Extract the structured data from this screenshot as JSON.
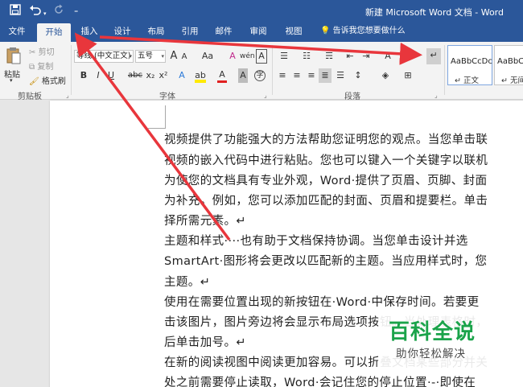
{
  "titlebar": {
    "save_icon": "save-icon",
    "undo_icon": "undo-icon",
    "redo_icon": "redo-icon",
    "customize_icon": "customize-qat-icon",
    "title": "新建 Microsoft Word 文档 - Word"
  },
  "tabs": [
    "文件",
    "开始",
    "插入",
    "设计",
    "布局",
    "引用",
    "邮件",
    "审阅",
    "视图"
  ],
  "active_tab": "开始",
  "tell_me": "告诉我您想要做什么",
  "clipboard": {
    "paste": "粘贴",
    "cut": "剪切",
    "copy": "复制",
    "format_painter": "格式刷",
    "group_label": "剪贴板"
  },
  "font": {
    "font_name": "等线 (中文正文)",
    "font_size": "五号",
    "grow": "A",
    "shrink": "A",
    "case": "Aa",
    "clear_format": "A",
    "phonetic": "wén",
    "border_char": "A",
    "bold": "B",
    "italic": "I",
    "underline": "U",
    "strike": "abc",
    "subscript": "x₂",
    "superscript": "x²",
    "text_effect": "A",
    "highlight": "ab",
    "font_color": "A",
    "char_shade": "A",
    "enclose": "字",
    "group_label": "字体"
  },
  "paragraph": {
    "group_label": "段落"
  },
  "styles": [
    {
      "sample": "AaBbCcDc",
      "name": "↵ 正文"
    },
    {
      "sample": "AaBbCcDc",
      "name": "↵ 无间"
    }
  ],
  "document": {
    "lines": [
      "视频提供了功能强大的方法帮助您证明您的观点。当您单击联",
      "视频的嵌入代码中进行粘贴。您也可以键入一个关键字以联机",
      "为使您的文档具有专业外观，Word·提供了页眉、页脚、封面",
      "为补充。例如，您可以添加匹配的封面、页眉和提要栏。单击",
      "择所需元素。↵",
      "主题和样式····也有助于文档保持协调。当您单击设计并选",
      "SmartArt·图形将会更改以匹配新的主题。当应用样式时，您",
      "主题。↵",
      "使用在需要位置出现的新按钮在·Word·中保存时间。若要更",
      "击该图片，图片旁边将会显示布局选项按钮。当处理表格时，",
      "后单击加号。↵",
      "在新的阅读视图中阅读更加容易。可以折叠文档某些部分并关",
      "处之前需要停止读取，Word·会记住您的停止位置·-·即使在"
    ]
  },
  "watermark": {
    "title": "百科全说",
    "subtitle": "助你轻松解决"
  },
  "colors": {
    "brand": "#2b579a",
    "arrow": "#e8363c",
    "watermark": "#1aa34a"
  }
}
